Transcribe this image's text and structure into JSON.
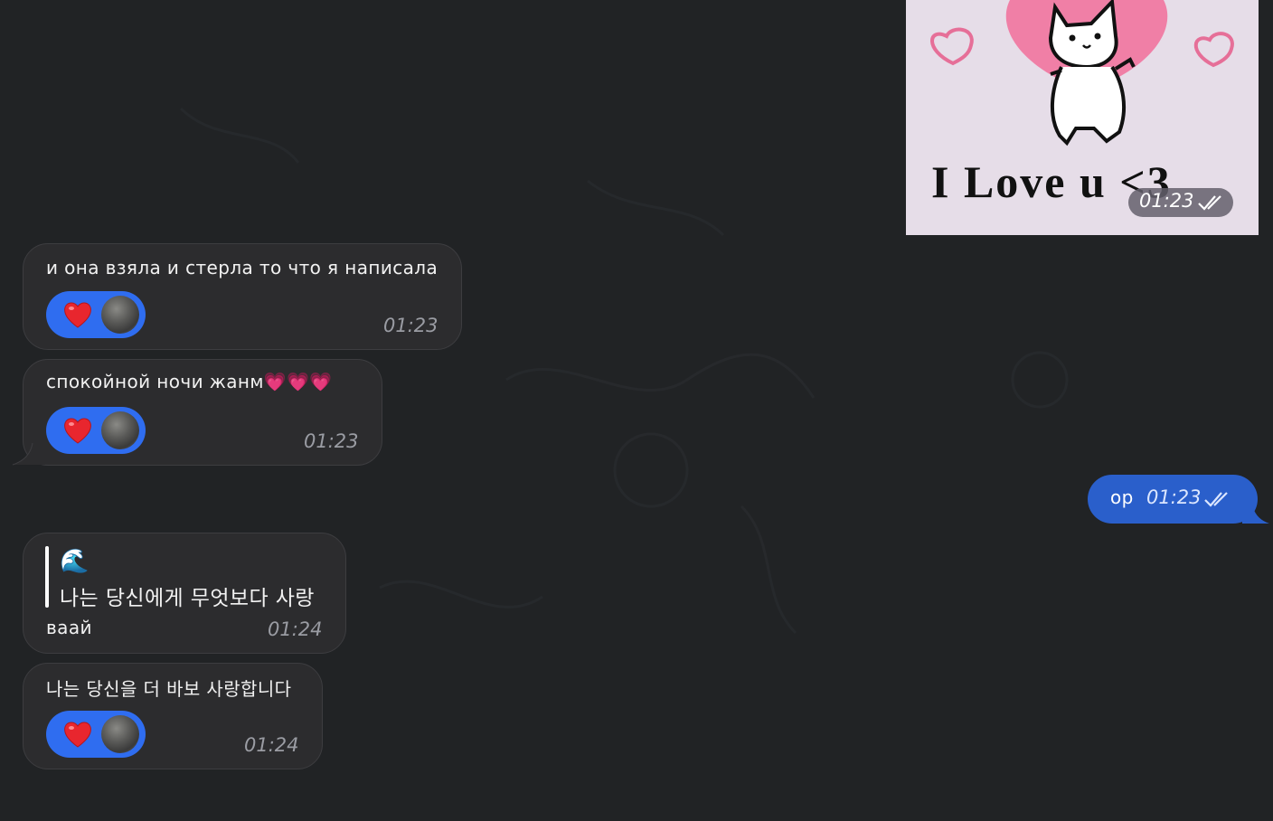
{
  "messages": {
    "photo": {
      "caption": "I Love u <3",
      "time": "01:23"
    },
    "m1": {
      "text": "и она взяла и стерла то что я написала",
      "time": "01:23",
      "reaction": "❤️"
    },
    "m2": {
      "text": "спокойной ночи жанм💗💗💗",
      "time": "01:23",
      "reaction": "❤️"
    },
    "m3": {
      "text": "ор",
      "time": "01:23"
    },
    "m4": {
      "quote_emoji": "🌊",
      "quote_text": "나는 당신에게 무엇보다 사랑",
      "text": "ваай",
      "time": "01:24"
    },
    "m5": {
      "text": "나는 당신을 더 바보 사랑합니다",
      "time": "01:24",
      "reaction": "❤️"
    }
  },
  "colors": {
    "background": "#212325",
    "incoming_bubble": "#2c2c2e",
    "outgoing_bubble": "#2a5fcb",
    "reaction_pill": "#2f6df0"
  }
}
